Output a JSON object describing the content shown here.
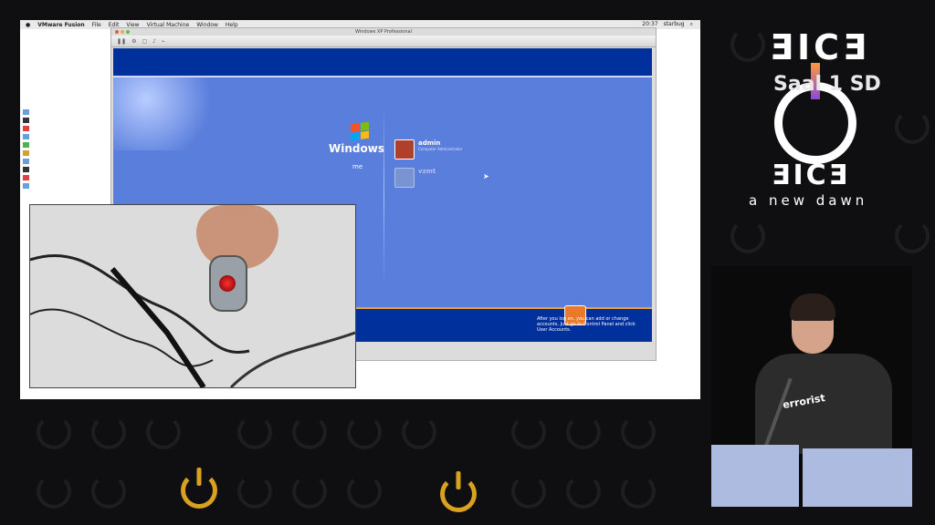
{
  "branding": {
    "logo_top": "ƎICƎ",
    "room": "Saal 1 SD",
    "logo_mid": "ƎICƎ",
    "tagline": "a new dawn"
  },
  "mac_menubar": {
    "items": [
      "VMware Fusion",
      "File",
      "Edit",
      "View",
      "Virtual Machine",
      "Window",
      "Help"
    ],
    "clock": "20:37",
    "user": "starbug"
  },
  "vm_window": {
    "title": "Windows XP Professional"
  },
  "xp_welcome": {
    "logo_text": "Windows",
    "welcome_fragment": "me",
    "users": [
      {
        "name": "admin",
        "subtitle": "Computer Administrator"
      },
      {
        "name": "vzmt",
        "subtitle": ""
      }
    ],
    "hint": "After you log on, you can add or change accounts. Just go to Control Panel and click User Accounts."
  },
  "speaker": {
    "shirt_text": "errorist"
  },
  "colors": {
    "xp_blue": "#5a7edc",
    "xp_dark_blue": "#00309c",
    "accent_gold": "#d9a11f"
  }
}
